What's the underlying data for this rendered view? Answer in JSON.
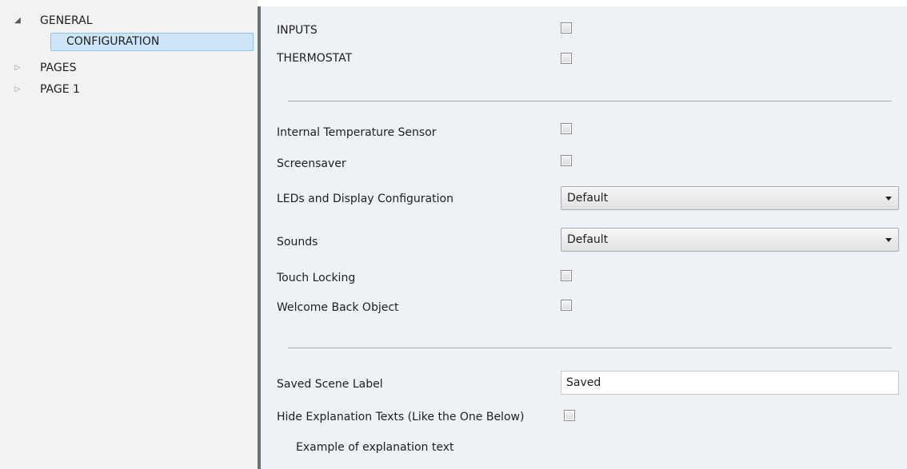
{
  "tree": {
    "items": [
      {
        "label": "GENERAL",
        "arrow": "expanded-arrow"
      },
      {
        "label": "CONFIGURATION",
        "selected": true
      },
      {
        "label": "PAGES",
        "arrow": "collapsed-arrow"
      },
      {
        "label": "PAGE 1",
        "arrow": "collapsed-arrow"
      }
    ]
  },
  "params": {
    "inputs": {
      "label": "INPUTS",
      "checked": false
    },
    "thermostat": {
      "label": "THERMOSTAT",
      "checked": false
    },
    "internal_temp_sensor": {
      "label": "Internal Temperature Sensor",
      "checked": false
    },
    "screensaver": {
      "label": "Screensaver",
      "checked": false
    },
    "leds_display": {
      "label": "LEDs and Display Configuration",
      "value": "Default"
    },
    "sounds": {
      "label": "Sounds",
      "value": "Default"
    },
    "touch_locking": {
      "label": "Touch Locking",
      "checked": false
    },
    "welcome_back": {
      "label": "Welcome Back Object",
      "checked": false
    },
    "saved_scene_label": {
      "label": "Saved Scene Label",
      "value": "Saved"
    },
    "hide_explanation": {
      "label": "Hide Explanation Texts (Like the One Below)",
      "checked": false
    },
    "explanation_example": "Example of explanation text"
  },
  "colors": {
    "tree_background": "#f2f2f2",
    "content_background": "#eef2f6",
    "selection": "#cde6f7",
    "selection_border": "#8fc3ea",
    "splitter": "#6f6f6f"
  }
}
